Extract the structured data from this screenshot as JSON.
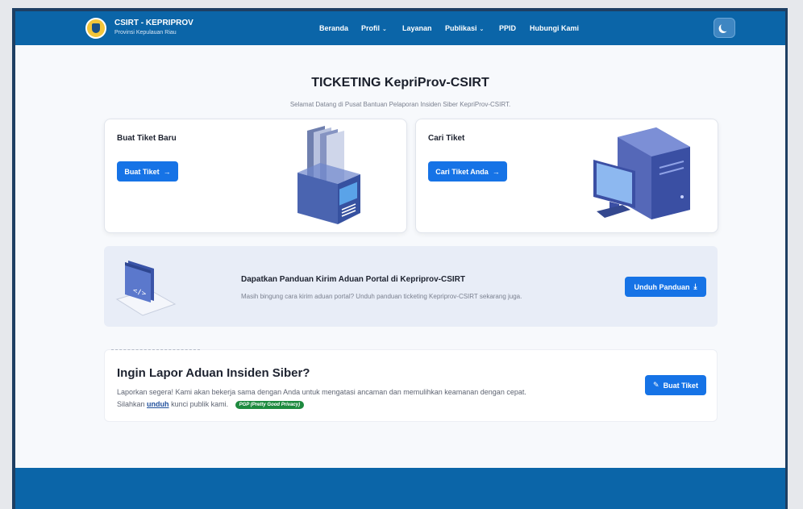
{
  "brand": {
    "title": "CSIRT - KEPRIPROV",
    "subtitle": "Provinsi Kepulauan Riau"
  },
  "nav": {
    "items": [
      {
        "label": "Beranda",
        "has_dropdown": false
      },
      {
        "label": "Profil",
        "has_dropdown": true
      },
      {
        "label": "Layanan",
        "has_dropdown": false
      },
      {
        "label": "Publikasi",
        "has_dropdown": true
      },
      {
        "label": "PPID",
        "has_dropdown": false
      },
      {
        "label": "Hubungi Kami",
        "has_dropdown": false
      }
    ],
    "theme_icon": "moon-icon"
  },
  "hero": {
    "title": "TICKETING KepriProv-CSIRT",
    "subtitle": "Selamat Datang di Pusat Bantuan Pelaporan Insiden Siber KepriProv-CSIRT."
  },
  "cards": {
    "new_ticket": {
      "title": "Buat Tiket Baru",
      "button": "Buat Tiket",
      "button_icon": "arrow-right-icon",
      "illustration": "document-box-icon"
    },
    "find_ticket": {
      "title": "Cari Tiket",
      "button": "Cari Tiket Anda",
      "button_icon": "arrow-right-icon",
      "illustration": "desktop-computer-icon"
    }
  },
  "guide": {
    "title": "Dapatkan Panduan Kirim Aduan Portal di Kepriprov-CSIRT",
    "description": "Masih bingung cara kirim aduan portal? Unduh panduan ticketing Kepriprov-CSIRT sekarang juga.",
    "button": "Unduh Panduan",
    "button_icon": "download-icon",
    "illustration": "code-window-icon"
  },
  "report": {
    "title": "Ingin Lapor Aduan Insiden Siber?",
    "line1": "Laporkan segera! Kami akan bekerja sama dengan Anda untuk mengatasi ancaman dan memulihkan keamanan dengan cepat.",
    "line2_prefix": "Silahkan",
    "line2_link": "unduh",
    "line2_suffix": "kunci publik kami.",
    "badge": "PGP (Pretty Good Privacy)",
    "button": "Buat Tiket",
    "button_icon": "pencil-icon"
  },
  "colors": {
    "navbar": "#0b65a8",
    "primary_button": "#1673e6",
    "badge": "#1e8a3f",
    "page_background": "#f7f9fc"
  }
}
